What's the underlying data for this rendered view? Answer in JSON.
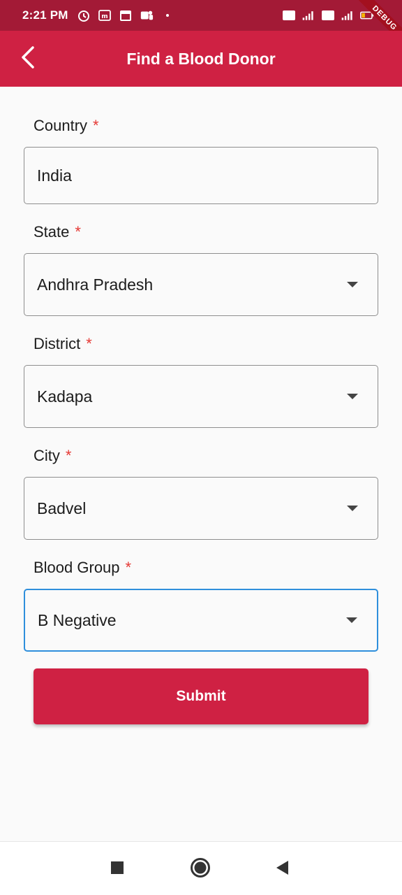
{
  "status_bar": {
    "time": "2:21 PM",
    "icons_left": [
      "alarm-icon",
      "m-icon",
      "calendar-icon",
      "teams-icon",
      "dot-icon"
    ],
    "icons_right": [
      "volte-icon",
      "signal-icon",
      "volte-icon",
      "4g-signal-icon",
      "battery-icon"
    ],
    "debug_label": "DEBUG"
  },
  "app_bar": {
    "title": "Find a Blood Donor",
    "back_icon": "chevron-left-icon",
    "color": "#cf2143"
  },
  "form": {
    "required_mark": "*",
    "fields": [
      {
        "label": "Country",
        "value": "India",
        "type": "text"
      },
      {
        "label": "State",
        "value": "Andhra Pradesh",
        "type": "dropdown"
      },
      {
        "label": "District",
        "value": "Kadapa",
        "type": "dropdown"
      },
      {
        "label": "City",
        "value": "Badvel",
        "type": "dropdown"
      },
      {
        "label": "Blood Group",
        "value": "B Negative",
        "type": "dropdown",
        "focused": true
      }
    ],
    "submit_label": "Submit"
  },
  "nav_bar": {
    "icons": [
      "recents-square-icon",
      "home-circle-icon",
      "back-triangle-icon"
    ]
  },
  "colors": {
    "status_bar": "#a31a36",
    "accent": "#cf2143",
    "required": "#e53935",
    "focus": "#2f8fdc"
  }
}
